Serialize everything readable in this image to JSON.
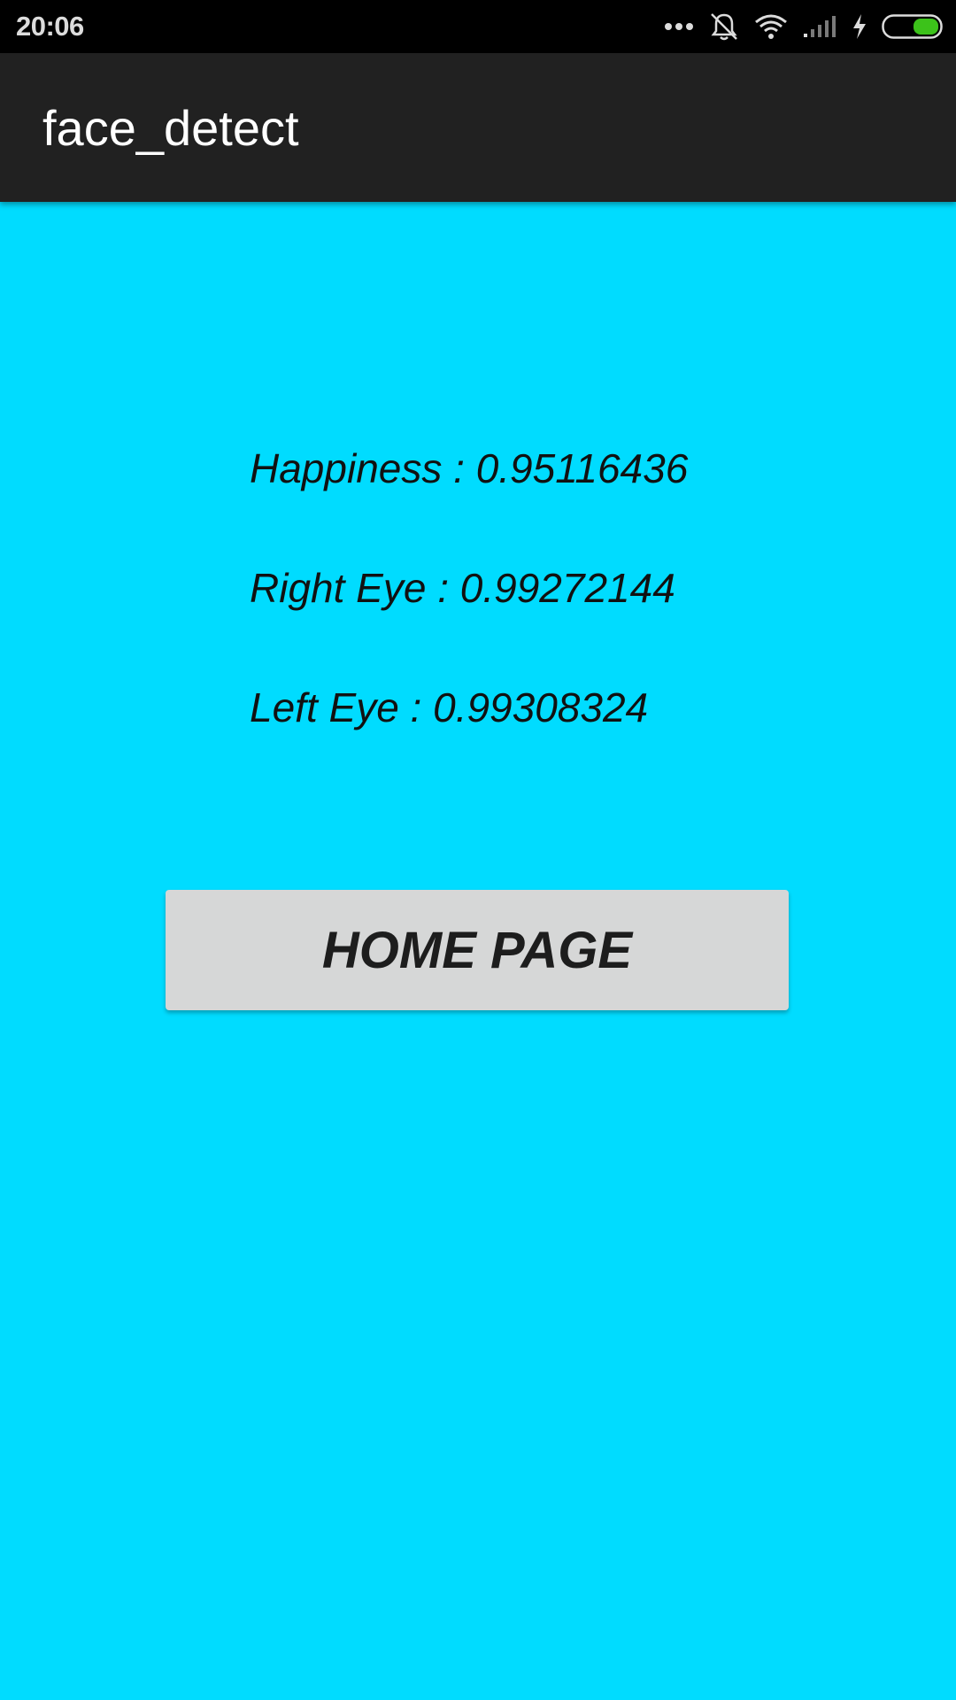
{
  "status_bar": {
    "time": "20:06",
    "icons": [
      "more-dots-icon",
      "vibrate-mute-icon",
      "wifi-icon",
      "signal-icon",
      "charging-bolt-icon",
      "battery-icon"
    ],
    "battery_color": "#3cc21a"
  },
  "app_bar": {
    "title": "face_detect",
    "background": "#212121"
  },
  "results": {
    "happiness": "Happiness : 0.95116436",
    "right_eye": "Right Eye : 0.99272144",
    "left_eye": "Left Eye : 0.99308324"
  },
  "actions": {
    "home_button_label": "HOME PAGE"
  },
  "colors": {
    "screen_background": "#00dcff",
    "button_background": "#d6d7d7"
  }
}
